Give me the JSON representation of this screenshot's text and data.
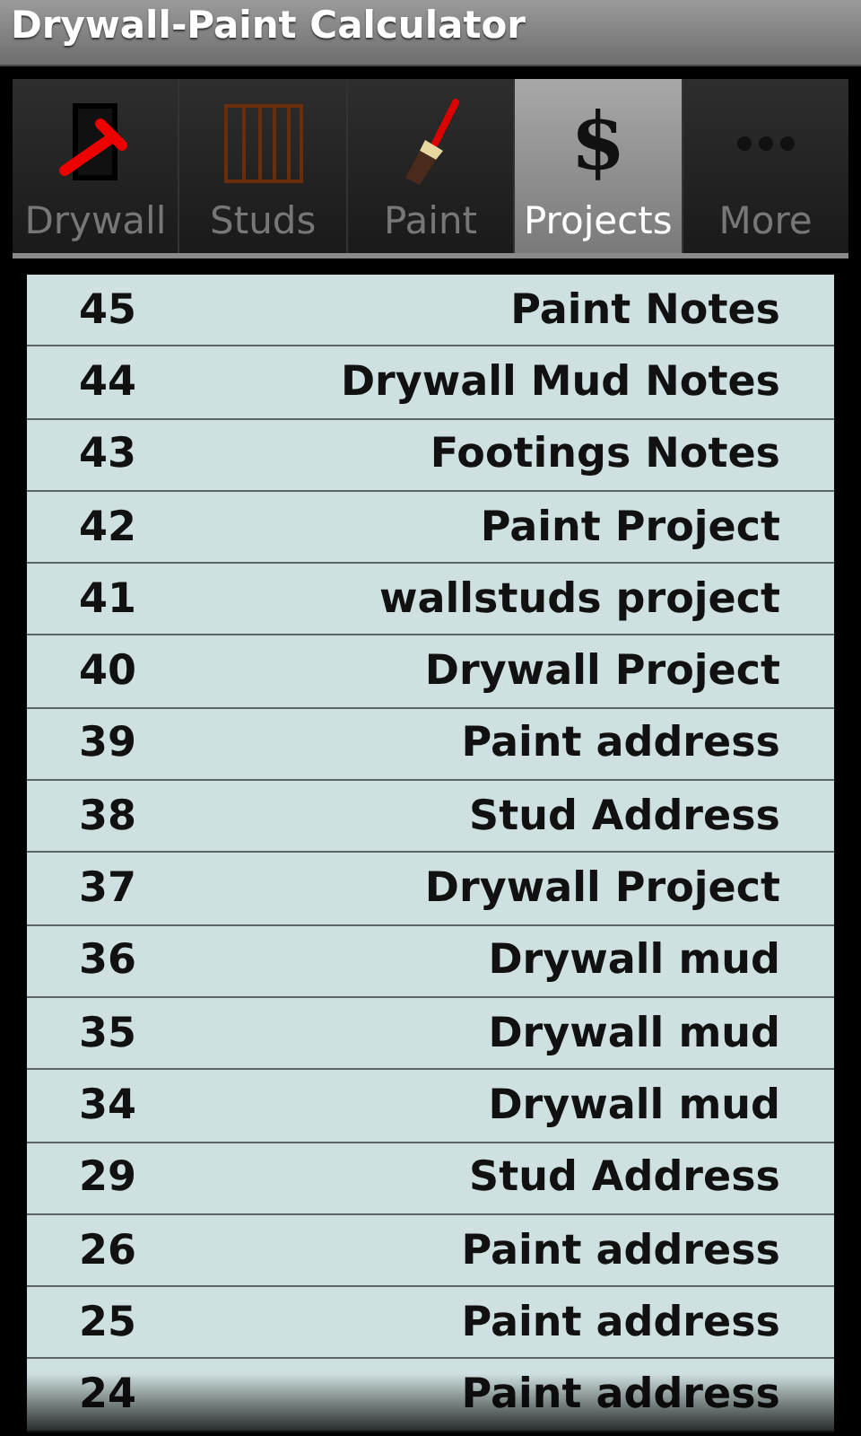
{
  "window": {
    "title": "Drywall-Paint Calculator"
  },
  "tabs": [
    {
      "label": "Drywall",
      "kind": "drywall",
      "selected": false
    },
    {
      "label": "Studs",
      "kind": "studs",
      "selected": false
    },
    {
      "label": "Paint",
      "kind": "paint",
      "selected": false
    },
    {
      "label": "Projects",
      "kind": "dollar",
      "icon_text": "$",
      "selected": true
    },
    {
      "label": "More",
      "kind": "more",
      "selected": false
    }
  ],
  "projects": [
    {
      "number": "45",
      "name": "Paint Notes"
    },
    {
      "number": "44",
      "name": "Drywall Mud Notes"
    },
    {
      "number": "43",
      "name": "Footings Notes"
    },
    {
      "number": "42",
      "name": "Paint Project"
    },
    {
      "number": "41",
      "name": "wallstuds project"
    },
    {
      "number": "40",
      "name": "Drywall Project"
    },
    {
      "number": "39",
      "name": "Paint address"
    },
    {
      "number": "38",
      "name": "Stud Address"
    },
    {
      "number": "37",
      "name": "Drywall Project"
    },
    {
      "number": "36",
      "name": "Drywall mud"
    },
    {
      "number": "35",
      "name": "Drywall mud"
    },
    {
      "number": "34",
      "name": "Drywall mud"
    },
    {
      "number": "29",
      "name": "Stud Address"
    },
    {
      "number": "26",
      "name": "Paint address"
    },
    {
      "number": "25",
      "name": "Paint address"
    },
    {
      "number": "24",
      "name": "Paint address"
    }
  ]
}
